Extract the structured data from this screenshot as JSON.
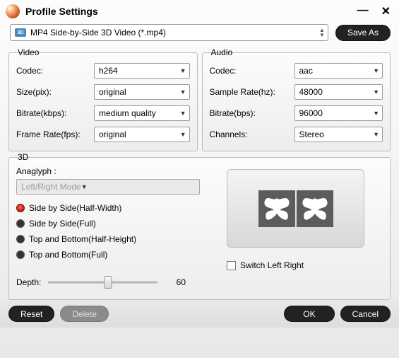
{
  "window": {
    "title": "Profile Settings"
  },
  "profile": {
    "icon_text": "3D",
    "text": "MP4 Side-by-Side 3D Video (*.mp4)",
    "save_as": "Save As"
  },
  "video": {
    "legend": "Video",
    "codec_label": "Codec:",
    "codec_value": "h264",
    "size_label": "Size(pix):",
    "size_value": "original",
    "bitrate_label": "Bitrate(kbps):",
    "bitrate_value": "medium quality",
    "framerate_label": "Frame Rate(fps):",
    "framerate_value": "original"
  },
  "audio": {
    "legend": "Audio",
    "codec_label": "Codec:",
    "codec_value": "aac",
    "samplerate_label": "Sample Rate(hz):",
    "samplerate_value": "48000",
    "bitrate_label": "Bitrate(bps):",
    "bitrate_value": "96000",
    "channels_label": "Channels:",
    "channels_value": "Stereo"
  },
  "threeD": {
    "legend": "3D",
    "anaglyph_label": "Anaglyph :",
    "anaglyph_value": "Left/Right Mode",
    "options": {
      "sbs_half": "Side by Side(Half-Width)",
      "sbs_full": "Side by Side(Full)",
      "tb_half": "Top and Bottom(Half-Height)",
      "tb_full": "Top and Bottom(Full)"
    },
    "depth_label": "Depth:",
    "depth_value": "60",
    "switch_label": "Switch Left Right"
  },
  "footer": {
    "reset": "Reset",
    "delete": "Delete",
    "ok": "OK",
    "cancel": "Cancel"
  }
}
